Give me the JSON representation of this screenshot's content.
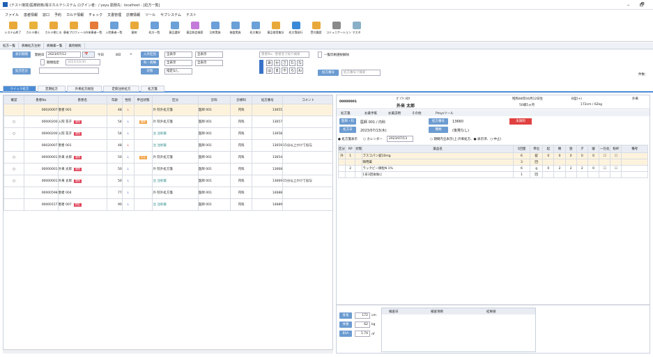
{
  "window": {
    "title": "(テスト環境)医療辞典/電子カルテシステム ログイン者：/ yayu 勤務先：localhost - [処方一覧]",
    "min": "–",
    "max": "🗗"
  },
  "menu": [
    "ファイル",
    "患者情報",
    "窓口",
    "予約",
    "カルテ情報",
    "チェック",
    "文書管理",
    "診療情報",
    "ツール",
    "サブシステム",
    "テスト"
  ],
  "toolbar": [
    "システム終了",
    "カルテ開く",
    "カルテ閉じる",
    "患者プロフィール",
    "外来患者一覧",
    "入院患者一覧",
    "薬剤",
    "処方一覧",
    "薬品選択",
    "薬品照会検索",
    "注射実施",
    "検査実施",
    "処方集計",
    "薬品使用集計",
    "処方箋発行",
    "受付履歴",
    "コミュニケーション",
    "マスタ"
  ],
  "tabs": [
    "処方一覧",
    "病棟処方注射",
    "病棟薬一覧",
    "薬剤規則"
  ],
  "filter": {
    "btn_day": "表示期間",
    "start_label": "開始日",
    "start": "2023/07/12",
    "today": "今日",
    "days": "8日",
    "end_chk": "期間指定",
    "end": "2023/10/30",
    "btn_rx": "処方区分",
    "rx_blank": "",
    "btn_type": "入外区別",
    "type_val": "全表示",
    "btn_dept": "科・病棟",
    "dept_val": "全表示",
    "btn_st": "状態",
    "st_val": "指定なし",
    "all1": "全表示",
    "all2": "全表示",
    "search_ph": "患者No、患者名で絞り検索",
    "kana": [
      "あ",
      "か",
      "さ",
      "た",
      "な",
      "は",
      "ま",
      "や",
      "ら",
      "わ"
    ],
    "chk_all": "一覧印刷選択解除",
    "btn_ord": "処方番号",
    "ord_ph": "処方番号で検索",
    "count": "件数："
  },
  "subtabs": [
    "ウイック処方",
    "定期処方",
    "外来処方総括",
    "定期注射処方",
    "処方箋"
  ],
  "list": {
    "headers": [
      "確認",
      "患者No",
      "患者名",
      "年齢",
      "性別",
      "申出状態",
      "区分",
      "診科",
      "診療科",
      "処方番号",
      "コメント"
    ],
    "rows": [
      {
        "ck": "",
        "no": "00020007",
        "name": "患者 001",
        "tag": "",
        "age": "48",
        "sex": "↓",
        "st": "",
        "kbn": "外 院外処方箋",
        "doc": "医師 001",
        "dept": "内科",
        "rx": "13655",
        "cm": "",
        "hl": true
      },
      {
        "ck": "○",
        "no": "00000200",
        "name": "入院 花子",
        "tag": "退院",
        "age": "54",
        "sex": "↓",
        "st": "鑑別",
        "kbn": "外 院外処方箋",
        "doc": "医師 001",
        "dept": "内科",
        "rx": "13657",
        "cm": ""
      },
      {
        "ck": "○",
        "no": "00000200",
        "name": "入院 花子",
        "tag": "退院",
        "age": "54",
        "sex": "↓",
        "st": "",
        "kbn": "注 注射薬",
        "doc": "医師 001",
        "dept": "内科",
        "rx": "13658",
        "cm": ""
      },
      {
        "ck": "",
        "no": "00020007",
        "name": "患者 001",
        "tag": "",
        "age": "48",
        "sex": "↓",
        "st": "",
        "kbn": "注 注射薬",
        "doc": "医師 001",
        "dept": "内科",
        "rx": "13659",
        "cm": "15分以上かけて投与"
      },
      {
        "ck": "○",
        "no": "00000001",
        "name": "外来 太郎",
        "tag": "退院",
        "age": "50",
        "sex": "↓",
        "st": "中止",
        "kbn": "外 院外処方箋",
        "doc": "医師 001",
        "dept": "内科",
        "rx": "13654",
        "cm": ""
      },
      {
        "ck": "○",
        "no": "00000001",
        "name": "外来 太郎",
        "tag": "退院",
        "age": "50",
        "sex": "↓",
        "st": "",
        "kbn": "外 院外処方箋",
        "doc": "医師 001",
        "dept": "内科",
        "rx": "13668",
        "cm": ""
      },
      {
        "ck": "○",
        "no": "00000001",
        "name": "外来 太郎",
        "tag": "退院",
        "age": "50",
        "sex": "↓",
        "st": "",
        "kbn": "注 注射薬",
        "doc": "医師 001",
        "dept": "内科",
        "rx": "13669",
        "cm": "15分以上かけて投与"
      },
      {
        "ck": "",
        "no": "00000598",
        "name": "患者 004",
        "tag": "",
        "age": "77",
        "sex": "↓",
        "st": "",
        "kbn": "外 院外処方箋",
        "doc": "医師 001",
        "dept": "内科",
        "rx": "14688",
        "cm": ""
      },
      {
        "ck": "",
        "no": "00000157",
        "name": "患者 007",
        "tag": "同姓",
        "age": "90",
        "sex": "↓",
        "st": "",
        "kbn": "注 注射薬",
        "doc": "医師 001",
        "dept": "内科",
        "rx": "14689",
        "cm": ""
      }
    ]
  },
  "patient": {
    "no": "00000001",
    "kana": "ｶﾞｲﾗｲ ﾀﾛｳ",
    "name": "外来 太郎",
    "birth": "昭和48年04月12日生",
    "age": "50歳5ヵ月",
    "blood": "B型(+)",
    "height_weight": "172cm / 62kg",
    "ward": "外来",
    "menu": [
      "処方箋",
      "お薬手帳",
      "お薬説明",
      "その他",
      "Pmysツール"
    ],
    "btn_date": "医師・科",
    "doc_dept": "医師 001 / 内科",
    "btn_no": "処方番号",
    "rx_no": "13660",
    "btn_day": "処方日",
    "rx_day": "2023/07/13(木)",
    "btn_kind": "種類",
    "kind": "(後発なし)",
    "status": "未調剤",
    "opt1": "処方箋表示",
    "opt2": "カレンダー",
    "cal_date": "2023/07/13",
    "opt3": "期間内全表示(上:外来処方、●:表示済、○:中止)",
    "rx_headers": [
      "区分",
      "RP",
      "状態",
      "薬品名",
      "1回量",
      "単位",
      "起",
      "朝",
      "昼",
      "夕",
      "寝",
      "一包化",
      "粉砕",
      "備考"
    ],
    "rx_rows": [
      {
        "k": "外",
        "rp": "1",
        "nm": "ブスコパン錠10mg",
        "q": "6",
        "u": "錠",
        "a": "0",
        "b": "0",
        "c": "0",
        "d": "0",
        "e": "0"
      },
      {
        "k": "",
        "rp": "",
        "nm": "頓用薬",
        "q": "3",
        "u": "回",
        "a": "",
        "b": "",
        "c": "",
        "d": "",
        "e": ""
      },
      {
        "k": "",
        "rp": "2",
        "nm": "ラックビー微粒N 1%",
        "q": "6",
        "u": "g",
        "a": "0",
        "b": "2",
        "c": "2",
        "d": "2",
        "e": "0"
      },
      {
        "k": "",
        "rp": "",
        "nm": "1日3回食後に",
        "q": "1",
        "u": "回",
        "a": "",
        "b": "",
        "c": "",
        "d": "",
        "e": ""
      }
    ],
    "bh": {
      "h_lbl": "身長",
      "h": "172",
      "h_u": "cm",
      "w_lbl": "体重",
      "w": "62",
      "w_u": "kg",
      "bmi_lbl": "BSA",
      "bmi": "1.74",
      "bmi_u": "㎡"
    },
    "lab_headers": [
      "検査日",
      "検査項目",
      "結果値"
    ]
  }
}
